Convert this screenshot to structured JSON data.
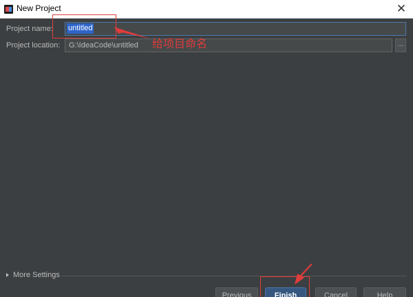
{
  "window": {
    "title": "New Project",
    "close_glyph": "✕"
  },
  "form": {
    "project_name_label": "Project name:",
    "project_name_value": "untitled",
    "project_location_label": "Project location:",
    "project_location_value": "G:\\IdeaCode\\untitled",
    "browse_label": "..."
  },
  "annotation": {
    "note": "给项目命名",
    "color": "#e03c3c"
  },
  "more_settings_label": "More Settings",
  "buttons": {
    "previous": "Previous",
    "finish": "Finish",
    "cancel": "Cancel",
    "help": "Help"
  },
  "colors": {
    "background": "#3c3f41",
    "selection": "#2f65ca",
    "accent_button": "#365880"
  },
  "icons": [
    "app-logo-icon",
    "close-icon",
    "chevron-right-icon"
  ]
}
